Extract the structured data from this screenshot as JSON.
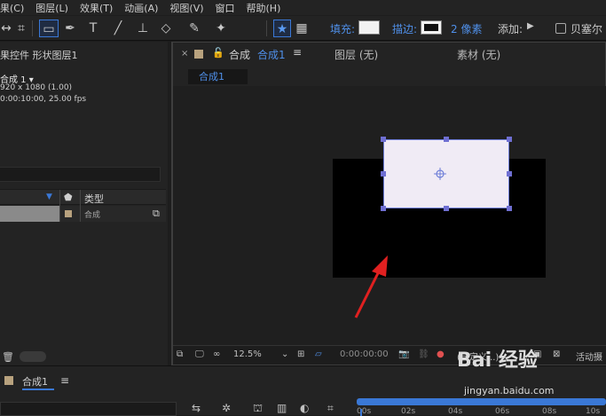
{
  "menu": [
    "果(C)",
    "图层(L)",
    "效果(T)",
    "动画(A)",
    "视图(V)",
    "窗口",
    "帮助(H)"
  ],
  "toolbar": {
    "fill_label": "填充:",
    "stroke_label": "描边:",
    "stroke_width": "2 像素",
    "add_label": "添加:",
    "bezier_label": "贝塞尔"
  },
  "left_panel": {
    "title": "果控件 形状图层1",
    "comp_name": "合成 1 ▾",
    "comp_size": "920 x 1080 (1.00)",
    "comp_duration": "0:00:10:00, 25.00 fps",
    "column_type": "类型",
    "row_type": "合成"
  },
  "viewer": {
    "tab_comp": "合成",
    "tab_comp_name": "合成1",
    "tab_layer": "图层 (无)",
    "tab_footage": "素材 (无)",
    "sub_tab": "合成1",
    "zoom": "12.5%",
    "timecode": "0:00:00:00",
    "custom": "(自定义...)",
    "active_camera": "活动摄"
  },
  "timeline": {
    "tab_name": "合成1",
    "ruler": [
      "00s",
      "02s",
      "04s",
      "06s",
      "08s",
      "10s"
    ]
  },
  "watermark": {
    "brand": "Bai 经验",
    "url": "jingyan.baidu.com"
  },
  "colors": {
    "accent": "#3a78d6",
    "shape_fill": "#f0ebf5",
    "handles": "#6f6fd2",
    "arrow": "#e02020"
  }
}
